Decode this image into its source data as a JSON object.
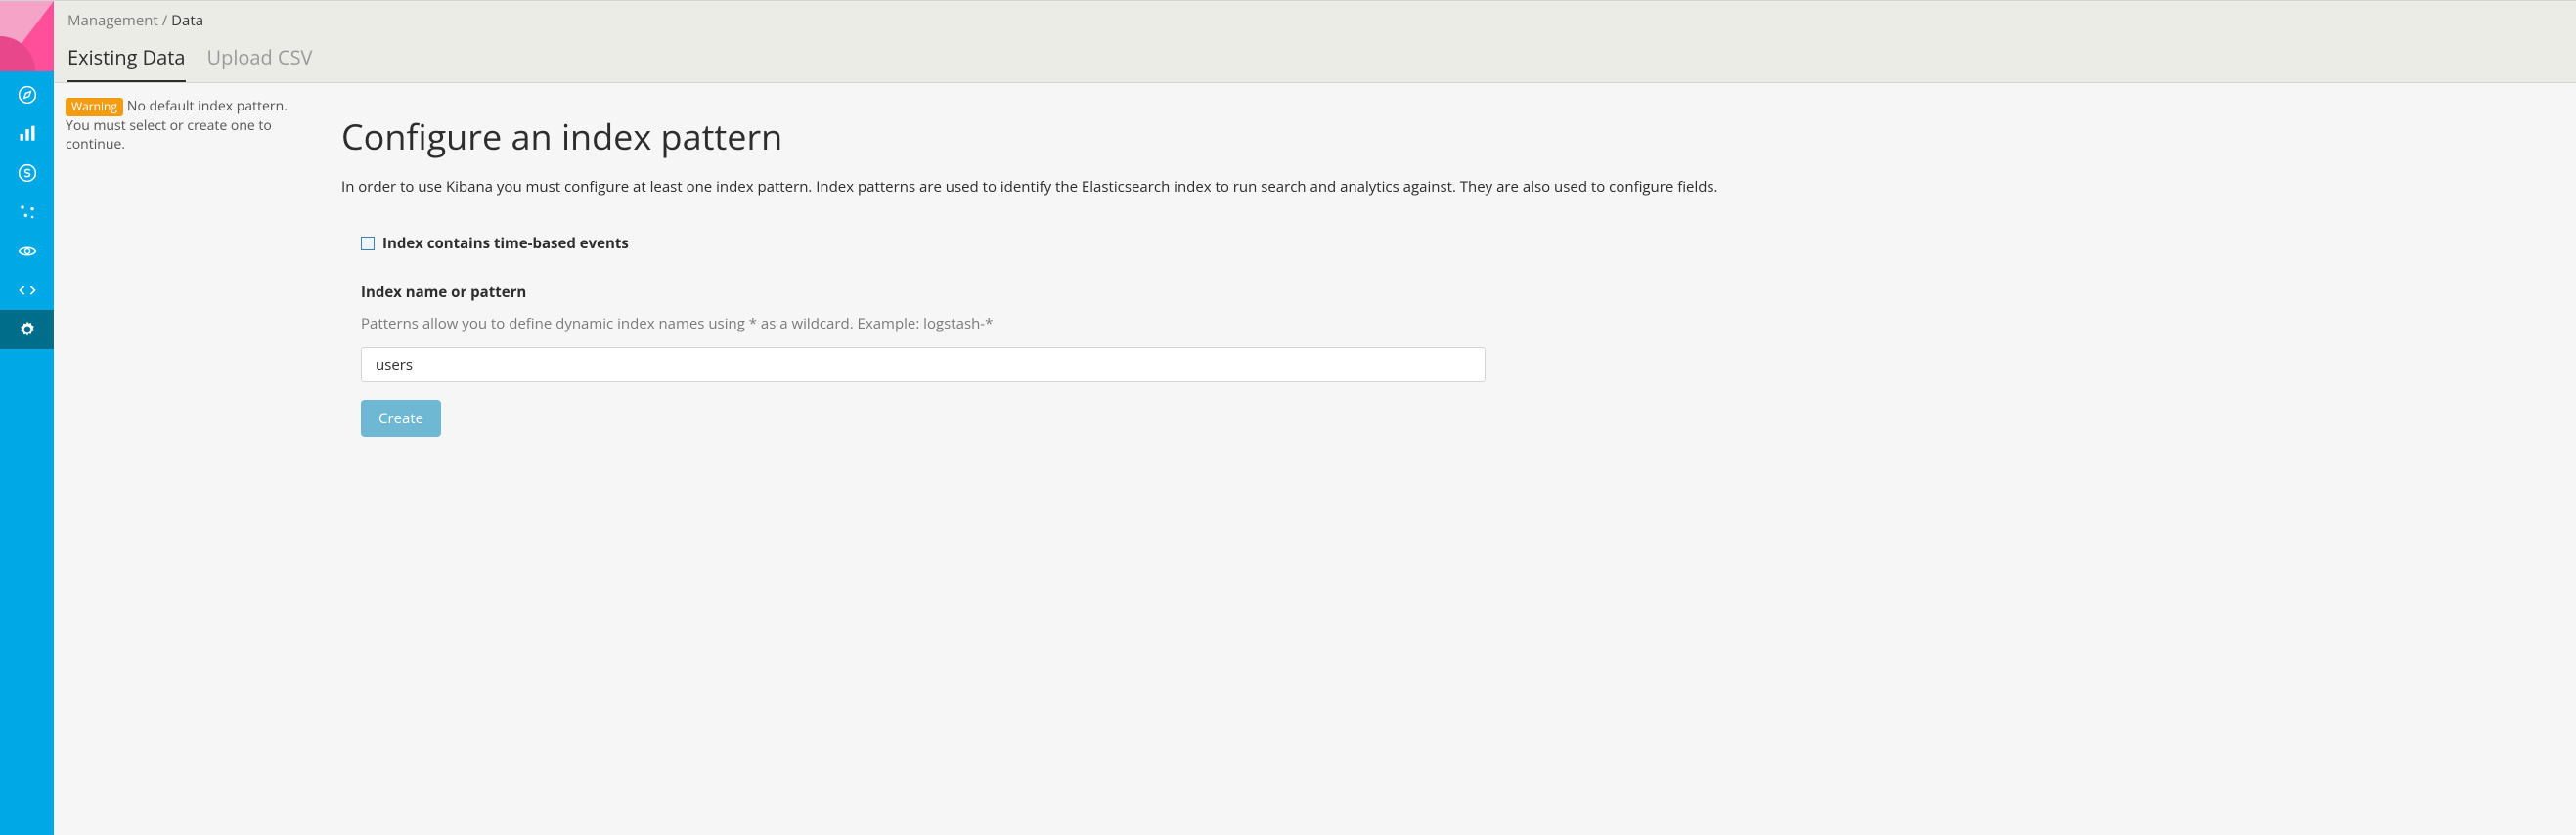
{
  "breadcrumb": {
    "parent": "Management",
    "sep": "/",
    "current": "Data"
  },
  "tabs": [
    {
      "label": "Existing Data",
      "active": true
    },
    {
      "label": "Upload CSV",
      "active": false
    }
  ],
  "warning": {
    "badge": "Warning",
    "text": "No default index pattern. You must select or create one to continue."
  },
  "page": {
    "title": "Configure an index pattern",
    "description": "In order to use Kibana you must configure at least one index pattern. Index patterns are used to identify the Elasticsearch index to run search and analytics against. They are also used to configure fields."
  },
  "form": {
    "time_checkbox_label": "Index contains time-based events",
    "time_checkbox_checked": false,
    "index_label": "Index name or pattern",
    "index_help": "Patterns allow you to define dynamic index names using * as a wildcard. Example: logstash-*",
    "index_value": "users",
    "create_label": "Create"
  },
  "nav": {
    "items": [
      {
        "name": "discover",
        "icon": "compass"
      },
      {
        "name": "visualize",
        "icon": "bar-chart"
      },
      {
        "name": "dashboard",
        "icon": "clock-dashboard"
      },
      {
        "name": "timelion",
        "icon": "sparkles"
      },
      {
        "name": "sense",
        "icon": "eye"
      },
      {
        "name": "devtools",
        "icon": "code"
      },
      {
        "name": "management",
        "icon": "gear",
        "active": true
      }
    ]
  }
}
